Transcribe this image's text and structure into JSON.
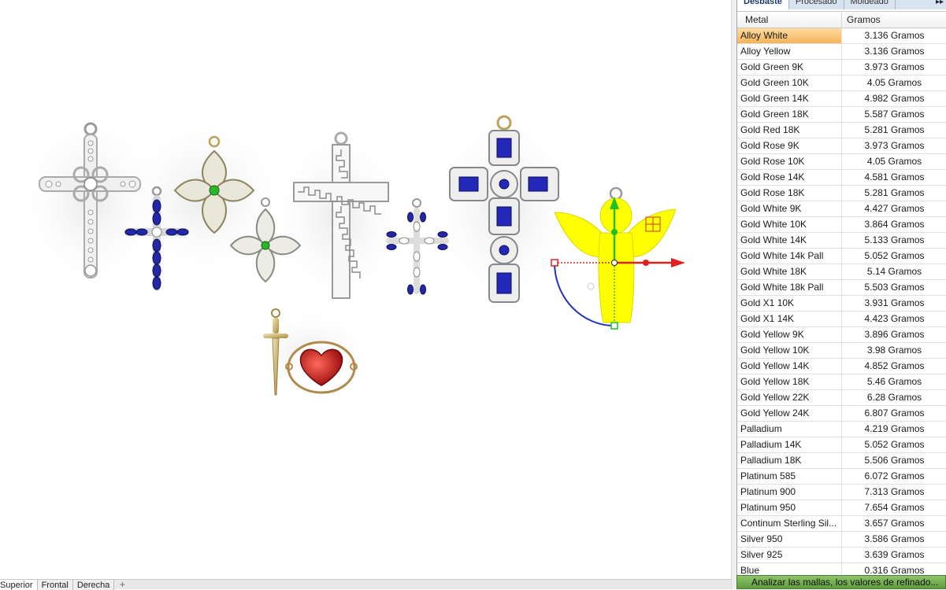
{
  "viewport": {
    "tabs": [
      "Superior",
      "Frontal",
      "Derecha"
    ],
    "active_tab": "Superior",
    "add_tab_symbol": "+"
  },
  "panel": {
    "tabs": [
      "Desbaste",
      "Procesado",
      "Moldeado"
    ],
    "active_tab": "Desbaste",
    "more_symbol": "▸▸",
    "columns": [
      "Metal",
      "Gramos"
    ],
    "selected_row": 0,
    "rows": [
      {
        "metal": "Alloy White",
        "grams": "3.136 Gramos"
      },
      {
        "metal": "Alloy Yellow",
        "grams": "3.136 Gramos"
      },
      {
        "metal": "Gold Green 9K",
        "grams": "3.973 Gramos"
      },
      {
        "metal": "Gold Green 10K",
        "grams": "4.05 Gramos"
      },
      {
        "metal": "Gold Green 14K",
        "grams": "4.982 Gramos"
      },
      {
        "metal": "Gold Green 18K",
        "grams": "5.587 Gramos"
      },
      {
        "metal": "Gold Red 18K",
        "grams": "5.281 Gramos"
      },
      {
        "metal": "Gold Rose 9K",
        "grams": "3.973 Gramos"
      },
      {
        "metal": "Gold Rose 10K",
        "grams": "4.05 Gramos"
      },
      {
        "metal": "Gold Rose 14K",
        "grams": "4.581 Gramos"
      },
      {
        "metal": "Gold Rose 18K",
        "grams": "5.281 Gramos"
      },
      {
        "metal": "Gold White 9K",
        "grams": "4.427 Gramos"
      },
      {
        "metal": "Gold White 10K",
        "grams": "3.864 Gramos"
      },
      {
        "metal": "Gold White 14K",
        "grams": "5.133 Gramos"
      },
      {
        "metal": "Gold White 14k Pall",
        "grams": "5.052 Gramos"
      },
      {
        "metal": "Gold White 18K",
        "grams": "5.14 Gramos"
      },
      {
        "metal": "Gold White 18k Pall",
        "grams": "5.503 Gramos"
      },
      {
        "metal": "Gold X1 10K",
        "grams": "3.931 Gramos"
      },
      {
        "metal": "Gold X1 14K",
        "grams": "4.423 Gramos"
      },
      {
        "metal": "Gold Yellow 9K",
        "grams": "3.896 Gramos"
      },
      {
        "metal": "Gold Yellow 10K",
        "grams": "3.98 Gramos"
      },
      {
        "metal": "Gold Yellow 14K",
        "grams": "4.852 Gramos"
      },
      {
        "metal": "Gold Yellow 18K",
        "grams": "5.46 Gramos"
      },
      {
        "metal": "Gold Yellow 22K",
        "grams": "6.28 Gramos"
      },
      {
        "metal": "Gold Yellow 24K",
        "grams": "6.807 Gramos"
      },
      {
        "metal": "Palladium",
        "grams": "4.219 Gramos"
      },
      {
        "metal": "Palladium 14K",
        "grams": "5.052 Gramos"
      },
      {
        "metal": "Palladium 18K",
        "grams": "5.506 Gramos"
      },
      {
        "metal": "Platinum 585",
        "grams": "6.072 Gramos"
      },
      {
        "metal": "Platinum 900",
        "grams": "7.313 Gramos"
      },
      {
        "metal": "Platinum 950",
        "grams": "7.654 Gramos"
      },
      {
        "metal": "Continum Sterling Sil...",
        "grams": "3.657 Gramos"
      },
      {
        "metal": "Silver 950",
        "grams": "3.586 Gramos"
      },
      {
        "metal": "Silver 925",
        "grams": "3.639 Gramos"
      },
      {
        "metal": "Blue",
        "grams": "0.316 Gramos"
      }
    ]
  },
  "status": {
    "message": "Analizar las mallas, los valores de refinado..."
  },
  "scene": {
    "objects": [
      "filigree-cross-pendant",
      "sapphire-cross-pendant",
      "clover-pendant",
      "greek-key-cross-pendant",
      "small-clover-pendant",
      "marquise-cross-pendant",
      "emerald-cut-cross-pendant",
      "angel-pendant",
      "sword-pendant",
      "heart-pendant"
    ],
    "selection_color": "#ffff00",
    "gizmo_colors": {
      "x": "#e02020",
      "y": "#20c020",
      "rotate": "#2030c0"
    }
  }
}
